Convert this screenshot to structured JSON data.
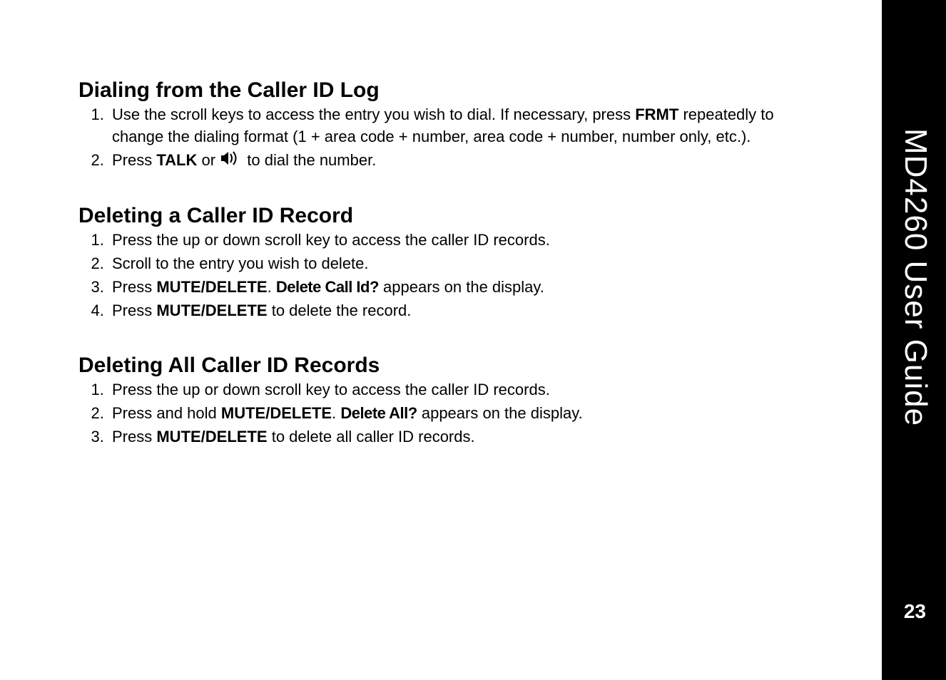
{
  "sidebar": {
    "title": "MD4260 User Guide",
    "page": "23"
  },
  "sections": [
    {
      "heading": "Dialing from the Caller ID Log",
      "items": [
        {
          "pre": "Use the scroll keys to access the entry you wish to dial. If necessary, press ",
          "bold1": "FRMT",
          "post": " repeatedly to change the dialing format (1 + area code + number, area code + number, number only, etc.)."
        },
        {
          "pre": "Press ",
          "bold1": "TALK",
          "mid": " or ",
          "icon": "speaker-icon",
          "post": " to dial the number."
        }
      ]
    },
    {
      "heading": "Deleting a Caller ID Record",
      "items": [
        {
          "pre": "Press the up or down scroll key to access the caller ID records."
        },
        {
          "pre": "Scroll to the entry you wish to delete."
        },
        {
          "pre": "Press ",
          "bold1": "MUTE/DELETE",
          "mid": ". ",
          "display": "Delete Call Id?",
          "post": " appears on the display."
        },
        {
          "pre": "Press ",
          "bold1": "MUTE/DELETE",
          "post": " to delete the record."
        }
      ]
    },
    {
      "heading": "Deleting All Caller ID Records",
      "items": [
        {
          "pre": "Press the up or down scroll key to access the caller ID records."
        },
        {
          "pre": "Press and hold ",
          "bold1": "MUTE/DELETE",
          "mid": ". ",
          "display": "Delete All?",
          "post": " appears on the display."
        },
        {
          "pre": "Press ",
          "bold1": "MUTE/DELETE",
          "post": " to delete all caller ID records."
        }
      ]
    }
  ]
}
